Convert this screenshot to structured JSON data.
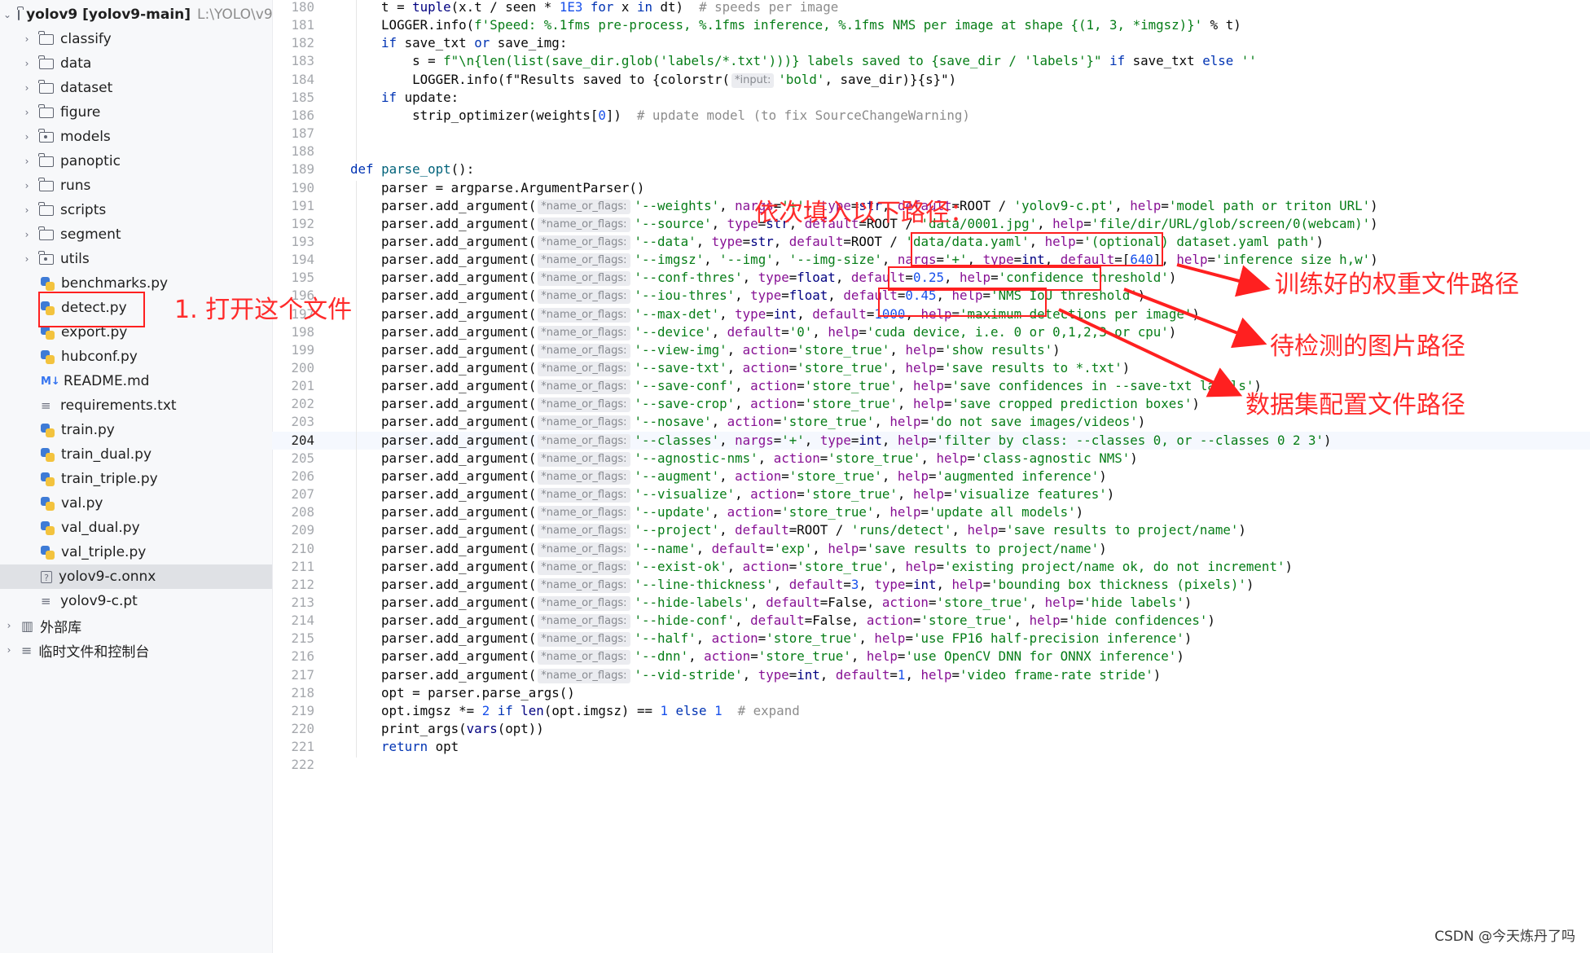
{
  "project": {
    "root_name": "yolov9 [yolov9-main]",
    "root_path": "L:\\YOLO\\v9\\",
    "items": [
      {
        "label": "classify",
        "type": "folder"
      },
      {
        "label": "data",
        "type": "folder"
      },
      {
        "label": "dataset",
        "type": "folder"
      },
      {
        "label": "figure",
        "type": "folder"
      },
      {
        "label": "models",
        "type": "package"
      },
      {
        "label": "panoptic",
        "type": "folder"
      },
      {
        "label": "runs",
        "type": "folder"
      },
      {
        "label": "scripts",
        "type": "folder"
      },
      {
        "label": "segment",
        "type": "folder"
      },
      {
        "label": "utils",
        "type": "package"
      },
      {
        "label": "benchmarks.py",
        "type": "py"
      },
      {
        "label": "detect.py",
        "type": "py"
      },
      {
        "label": "export.py",
        "type": "py"
      },
      {
        "label": "hubconf.py",
        "type": "py"
      },
      {
        "label": "README.md",
        "type": "md"
      },
      {
        "label": "requirements.txt",
        "type": "txt"
      },
      {
        "label": "train.py",
        "type": "py"
      },
      {
        "label": "train_dual.py",
        "type": "py"
      },
      {
        "label": "train_triple.py",
        "type": "py"
      },
      {
        "label": "val.py",
        "type": "py"
      },
      {
        "label": "val_dual.py",
        "type": "py"
      },
      {
        "label": "val_triple.py",
        "type": "py"
      },
      {
        "label": "yolov9-c.onnx",
        "type": "unknown"
      },
      {
        "label": "yolov9-c.pt",
        "type": "txt"
      }
    ],
    "selected_index": 22,
    "external_libs": "外部库",
    "scratches": "临时文件和控制台"
  },
  "editor": {
    "current_line": 204,
    "param_hint": "*name_or_flags:",
    "input_hint": "*input:",
    "lines": [
      {
        "n": "180",
        "text": "t = tuple(x.t / seen * 1E3 for x in dt)  # speeds per image"
      },
      {
        "n": "181",
        "text": "LOGGER.info(f'Speed: %.1fms pre-process, %.1fms inference, %.1fms NMS per image at shape {(1, 3, *imgsz)}' % t)"
      },
      {
        "n": "182",
        "text": "if save_txt or save_img:"
      },
      {
        "n": "183",
        "text": "s = f\"\\n{len(list(save_dir.glob('labels/*.txt')))} labels saved to {save_dir / 'labels'}\" if save_txt else ''"
      },
      {
        "n": "184",
        "text": "LOGGER.info(f\"Results saved to {colorstr('bold', save_dir)}{s}\")"
      },
      {
        "n": "185",
        "text": "if update:"
      },
      {
        "n": "186",
        "text": "strip_optimizer(weights[0])  # update model (to fix SourceChangeWarning)"
      },
      {
        "n": "187",
        "text": ""
      },
      {
        "n": "188",
        "text": ""
      },
      {
        "n": "189",
        "text": "def parse_opt():"
      },
      {
        "n": "190",
        "text": "parser = argparse.ArgumentParser()"
      },
      {
        "n": "191",
        "text": "'--weights', nargs='+', type=str, default=ROOT / 'yolov9-c.pt', help='model path or triton URL')"
      },
      {
        "n": "192",
        "text": "'--source', type=str, default=ROOT / 'data/0001.jpg', help='file/dir/URL/glob/screen/0(webcam)')"
      },
      {
        "n": "193",
        "text": "'--data', type=str, default=ROOT / 'data/data.yaml', help='(optional) dataset.yaml path')"
      },
      {
        "n": "194",
        "text": "'--imgsz', '--img', '--img-size', nargs='+', type=int, default=[640], help='inference size h,w')"
      },
      {
        "n": "195",
        "text": "'--conf-thres', type=float, default=0.25, help='confidence threshold')"
      },
      {
        "n": "196",
        "text": "'--iou-thres', type=float, default=0.45, help='NMS IoU threshold')"
      },
      {
        "n": "197",
        "text": "'--max-det', type=int, default=1000, help='maximum detections per image')"
      },
      {
        "n": "198",
        "text": "'--device', default='0', help='cuda device, i.e. 0 or 0,1,2,3 or cpu')"
      },
      {
        "n": "199",
        "text": "'--view-img', action='store_true', help='show results')"
      },
      {
        "n": "200",
        "text": "'--save-txt', action='store_true', help='save results to *.txt')"
      },
      {
        "n": "201",
        "text": "'--save-conf', action='store_true', help='save confidences in --save-txt labels')"
      },
      {
        "n": "202",
        "text": "'--save-crop', action='store_true', help='save cropped prediction boxes')"
      },
      {
        "n": "203",
        "text": "'--nosave', action='store_true', help='do not save images/videos')"
      },
      {
        "n": "204",
        "text": "'--classes', nargs='+', type=int, help='filter by class: --classes 0, or --classes 0 2 3')"
      },
      {
        "n": "205",
        "text": "'--agnostic-nms', action='store_true', help='class-agnostic NMS')"
      },
      {
        "n": "206",
        "text": "'--augment', action='store_true', help='augmented inference')"
      },
      {
        "n": "207",
        "text": "'--visualize', action='store_true', help='visualize features')"
      },
      {
        "n": "208",
        "text": "'--update', action='store_true', help='update all models')"
      },
      {
        "n": "209",
        "text": "'--project', default=ROOT / 'runs/detect', help='save results to project/name')"
      },
      {
        "n": "210",
        "text": "'--name', default='exp', help='save results to project/name')"
      },
      {
        "n": "211",
        "text": "'--exist-ok', action='store_true', help='existing project/name ok, do not increment')"
      },
      {
        "n": "212",
        "text": "'--line-thickness', default=3, type=int, help='bounding box thickness (pixels)')"
      },
      {
        "n": "213",
        "text": "'--hide-labels', default=False, action='store_true', help='hide labels')"
      },
      {
        "n": "214",
        "text": "'--hide-conf', default=False, action='store_true', help='hide confidences')"
      },
      {
        "n": "215",
        "text": "'--half', action='store_true', help='use FP16 half-precision inference')"
      },
      {
        "n": "216",
        "text": "'--dnn', action='store_true', help='use OpenCV DNN for ONNX inference')"
      },
      {
        "n": "217",
        "text": "'--vid-stride', type=int, default=1, help='video frame-rate stride')"
      },
      {
        "n": "218",
        "text": "opt = parser.parse_args()"
      },
      {
        "n": "219",
        "text": "opt.imgsz *= 2 if len(opt.imgsz) == 1 else 1  # expand"
      },
      {
        "n": "220",
        "text": "print_args(vars(opt))"
      },
      {
        "n": "221",
        "text": "return opt"
      },
      {
        "n": "222",
        "text": ""
      }
    ]
  },
  "annotations": {
    "step1": "1. 打开这个文件",
    "fill_in": "依次填入以下路径：",
    "weights_label": "训练好的权重文件路径",
    "image_label": "待检测的图片路径",
    "dataset_label": "数据集配置文件路径",
    "color": "#ff2020"
  },
  "watermark": "CSDN @今天炼丹了吗"
}
